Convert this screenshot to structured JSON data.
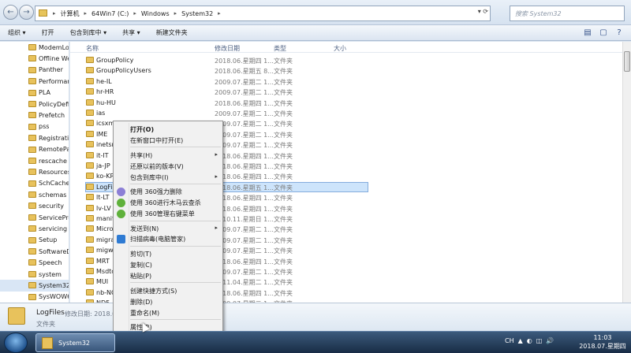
{
  "address": {
    "crumbs": [
      "计算机",
      "64Win7 (C:)",
      "Windows",
      "System32"
    ],
    "search_placeholder": "搜索 System32",
    "back": "←",
    "forward": "→",
    "dropdown": "▾",
    "refresh": "⟳"
  },
  "toolbar": {
    "organize": "组织 ▾",
    "open": "打开",
    "include": "包含到库中 ▾",
    "share": "共享 ▾",
    "new_folder": "新建文件夹"
  },
  "columns": {
    "name": "名称",
    "date": "修改日期",
    "type": "类型",
    "size": "大小"
  },
  "nav": {
    "items": [
      "ModemLo",
      "Offline We",
      "Panther",
      "Performan",
      "PLA",
      "PolicyDefi",
      "Prefetch",
      "pss",
      "Registratio",
      "RemotePa",
      "rescache",
      "Resources",
      "SchCache",
      "schemas",
      "security",
      "ServicePro",
      "servicing",
      "Setup",
      "SoftwareD",
      "Speech",
      "system",
      "System32",
      "SysWOW6"
    ]
  },
  "files": [
    {
      "name": "GroupPolicy",
      "date": "2018.06.星期四 1...",
      "type": "文件夹"
    },
    {
      "name": "GroupPolicyUsers",
      "date": "2018.06.星期五 8...",
      "type": "文件夹"
    },
    {
      "name": "he-IL",
      "date": "2009.07.星期二 1...",
      "type": "文件夹"
    },
    {
      "name": "hr-HR",
      "date": "2009.07.星期二 1...",
      "type": "文件夹"
    },
    {
      "name": "hu-HU",
      "date": "2018.06.星期四 1...",
      "type": "文件夹"
    },
    {
      "name": "ias",
      "date": "2009.07.星期二 1...",
      "type": "文件夹"
    },
    {
      "name": "icsxml",
      "date": "2009.07.星期二 1...",
      "type": "文件夹"
    },
    {
      "name": "IME",
      "date": "2009.07.星期二 1...",
      "type": "文件夹"
    },
    {
      "name": "inetsrv",
      "date": "2009.07.星期二 1...",
      "type": "文件夹"
    },
    {
      "name": "it-IT",
      "date": "2018.06.星期四 1...",
      "type": "文件夹"
    },
    {
      "name": "ja-JP",
      "date": "2018.06.星期四 1...",
      "type": "文件夹"
    },
    {
      "name": "ko-KR",
      "date": "2018.06.星期四 1...",
      "type": "文件夹"
    },
    {
      "name": "LogFiles",
      "date": "2018.06.星期五 1...",
      "type": "文件夹"
    },
    {
      "name": "lt-LT",
      "date": "2018.06.星期四 1...",
      "type": "文件夹"
    },
    {
      "name": "lv-LV",
      "date": "2018.06.星期四 1...",
      "type": "文件夹"
    },
    {
      "name": "manif",
      "date": "2010.11.星期日 1...",
      "type": "文件夹"
    },
    {
      "name": "Micro",
      "date": "2009.07.星期二 1...",
      "type": "文件夹"
    },
    {
      "name": "migra",
      "date": "2009.07.星期二 1...",
      "type": "文件夹"
    },
    {
      "name": "migwi",
      "date": "2009.07.星期二 1...",
      "type": "文件夹"
    },
    {
      "name": "MRT",
      "date": "2018.06.星期四 1...",
      "type": "文件夹"
    },
    {
      "name": "Msdtc",
      "date": "2009.07.星期二 1...",
      "type": "文件夹"
    },
    {
      "name": "MUI",
      "date": "2011.04.星期二 1...",
      "type": "文件夹"
    },
    {
      "name": "nb-NO",
      "date": "2018.06.星期四 1...",
      "type": "文件夹"
    },
    {
      "name": "NDF",
      "date": "2009.07.星期二 1...",
      "type": "文件夹"
    }
  ],
  "context_menu": {
    "open": "打开(O)",
    "open_new_window": "在新窗口中打开(E)",
    "share": "共享(H)",
    "restore": "还原以前的版本(V)",
    "include": "包含到库中(I)",
    "del360": "使用 360强力删除",
    "scan360": "使用 360进行木马云查杀",
    "menu360": "使用 360管理右键菜单",
    "send_to": "发送到(N)",
    "virus_scan": "扫描病毒(电脑管家)",
    "cut": "剪切(T)",
    "copy": "复制(C)",
    "paste": "粘贴(P)",
    "shortcut": "创建快捷方式(S)",
    "delete": "删除(D)",
    "rename": "重命名(M)",
    "properties": "属性(R)",
    "submenu_arrow": "▸"
  },
  "details": {
    "name": "LogFiles",
    "meta": "修改日期: 2018.06",
    "type": "文件夹"
  },
  "taskbar": {
    "task": "System32",
    "tray": [
      "CH",
      "▲",
      "◐",
      "◫",
      "🔊"
    ],
    "time": "11:03",
    "date": "2018.07.星期四"
  },
  "colors": {
    "selection": "#cde4fb",
    "folder": "#e8c25c",
    "taskbar": "#1e3553"
  }
}
